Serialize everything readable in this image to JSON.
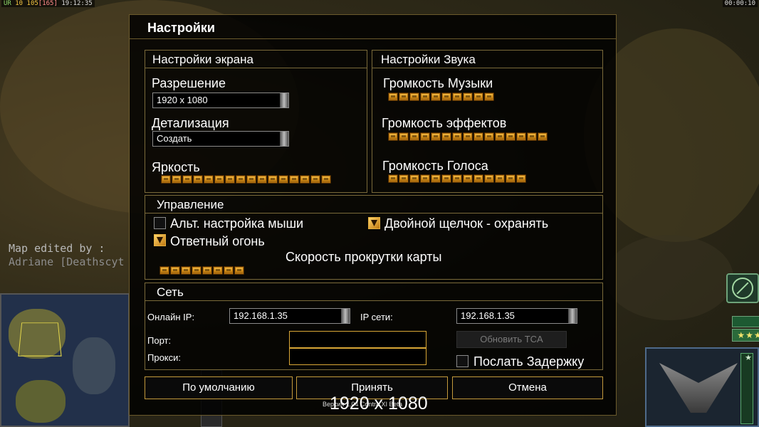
{
  "hud": {
    "top_left_a": "UR",
    "top_left_b": "10",
    "top_left_c": "105",
    "top_left_d": "[165]",
    "time": "19:12:35",
    "top_right": "00:00:10"
  },
  "map_credit": {
    "line1": "Map edited by :",
    "line2": "Adriane [Deathscyt"
  },
  "dialog": {
    "title": "Настройки",
    "screen": {
      "title": "Настройки экрана",
      "resolution_label": "Разрешение",
      "resolution_value": "1920 x 1080",
      "detail_label": "Детализация",
      "detail_value": "Создать",
      "brightness_label": "Яркость",
      "brightness_level": 16
    },
    "sound": {
      "title": "Настройки Звука",
      "music_label": "Громкость Музыки",
      "music_level": 10,
      "effects_label": "Громкость эффектов",
      "effects_level": 15,
      "voice_label": "Громкость Голоса",
      "voice_level": 13
    },
    "controls": {
      "title": "Управление",
      "alt_mouse_label": "Альт. настройка мыши",
      "alt_mouse_checked": false,
      "double_click_label": "Двойной щелчок - охранять",
      "double_click_checked": true,
      "return_fire_label": "Ответный огонь",
      "return_fire_checked": true,
      "scroll_label": "Скорость прокрутки карты",
      "scroll_level": 8
    },
    "network": {
      "title": "Сеть",
      "online_ip_label": "Онлайн IP:",
      "online_ip_value": "192.168.1.35",
      "lan_ip_label": "IP сети:",
      "lan_ip_value": "192.168.1.35",
      "port_label": "Порт:",
      "port_value": "",
      "proxy_label": "Прокси:",
      "proxy_value": "",
      "update_tca_label": "Обновить TCA",
      "send_delay_label": "Послать Задержку",
      "send_delay_checked": false
    },
    "buttons": {
      "default": "По умолчанию",
      "accept": "Принять",
      "cancel": "Отмена"
    }
  },
  "overlay_text": "1920 x 1080",
  "version_text": "Версия 1.04 Contra XI Beta",
  "colors": {
    "accent_gold": "#c49a3c",
    "slider_gold": "#f7c24d",
    "panel_bg": "#000000"
  }
}
